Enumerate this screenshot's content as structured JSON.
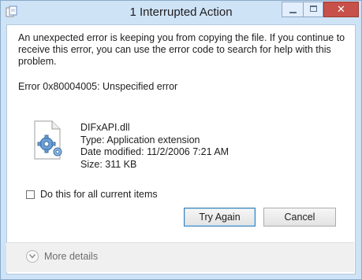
{
  "window": {
    "title": "1 Interrupted Action",
    "icons": {
      "system": "copy-icon",
      "minimize": "minimize-icon",
      "maximize": "maximize-icon",
      "close": "close-icon"
    },
    "close_glyph": "✕",
    "close_color": "#c7514a"
  },
  "body": {
    "message": "An unexpected error is keeping you from copying the file. If you continue to receive this error, you can use the error code to search for help with this problem.",
    "error": "Error 0x80004005: Unspecified error"
  },
  "file": {
    "icon": "dll-settings-file-icon",
    "name": "DIFxAPI.dll",
    "type": "Type: Application extension",
    "modified": "Date modified: 11/2/2006 7:21 AM",
    "size": "Size: 311 KB"
  },
  "checkbox": {
    "label": "Do this for all current items",
    "checked": false
  },
  "buttons": {
    "try_again": "Try Again",
    "cancel": "Cancel"
  },
  "footer": {
    "more_details": "More details",
    "icon": "chevron-down-icon"
  }
}
